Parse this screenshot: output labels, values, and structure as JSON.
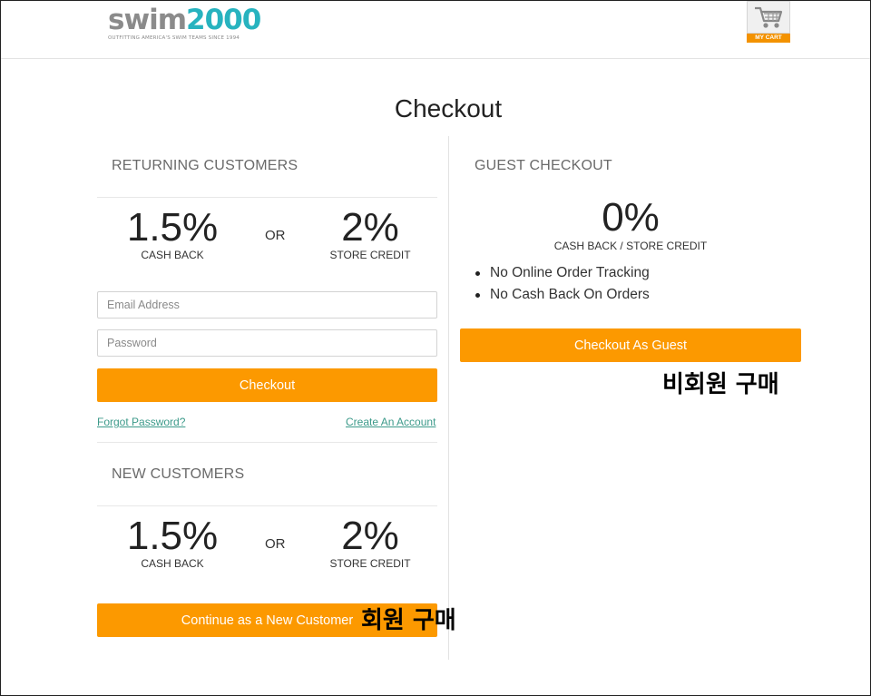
{
  "header": {
    "logo_swim": "swim",
    "logo_num": "2000",
    "logo_tagline": "OUTFITTING AMERICA'S SWIM TEAMS SINCE 1994",
    "cart_label": "MY CART",
    "cart_icon": "shopping-cart-icon"
  },
  "page": {
    "title": "Checkout"
  },
  "returning": {
    "title": "RETURNING CUSTOMERS",
    "cashback_value": "1.5%",
    "cashback_label": "CASH BACK",
    "or_label": "OR",
    "credit_value": "2%",
    "credit_label": "STORE CREDIT",
    "email_placeholder": "Email Address",
    "email_value": "",
    "password_placeholder": "Password",
    "password_value": "",
    "checkout_button": "Checkout",
    "forgot_link": "Forgot Password?",
    "create_link": "Create An Account"
  },
  "new_customers": {
    "title": "NEW CUSTOMERS",
    "cashback_value": "1.5%",
    "cashback_label": "CASH BACK",
    "or_label": "OR",
    "credit_value": "2%",
    "credit_label": "STORE CREDIT",
    "continue_button": "Continue as a New Customer"
  },
  "guest": {
    "title": "GUEST CHECKOUT",
    "value": "0%",
    "label": "CASH BACK / STORE CREDIT",
    "bullets": [
      "No Online Order Tracking",
      "No Cash Back On Orders"
    ],
    "button": "Checkout As Guest"
  },
  "annotations": {
    "guest_note": "비회원 구매",
    "member_note": "회원 구매"
  },
  "colors": {
    "accent": "#fc9900",
    "logo_teal": "#27b3bf",
    "link": "#3c9a8a"
  }
}
